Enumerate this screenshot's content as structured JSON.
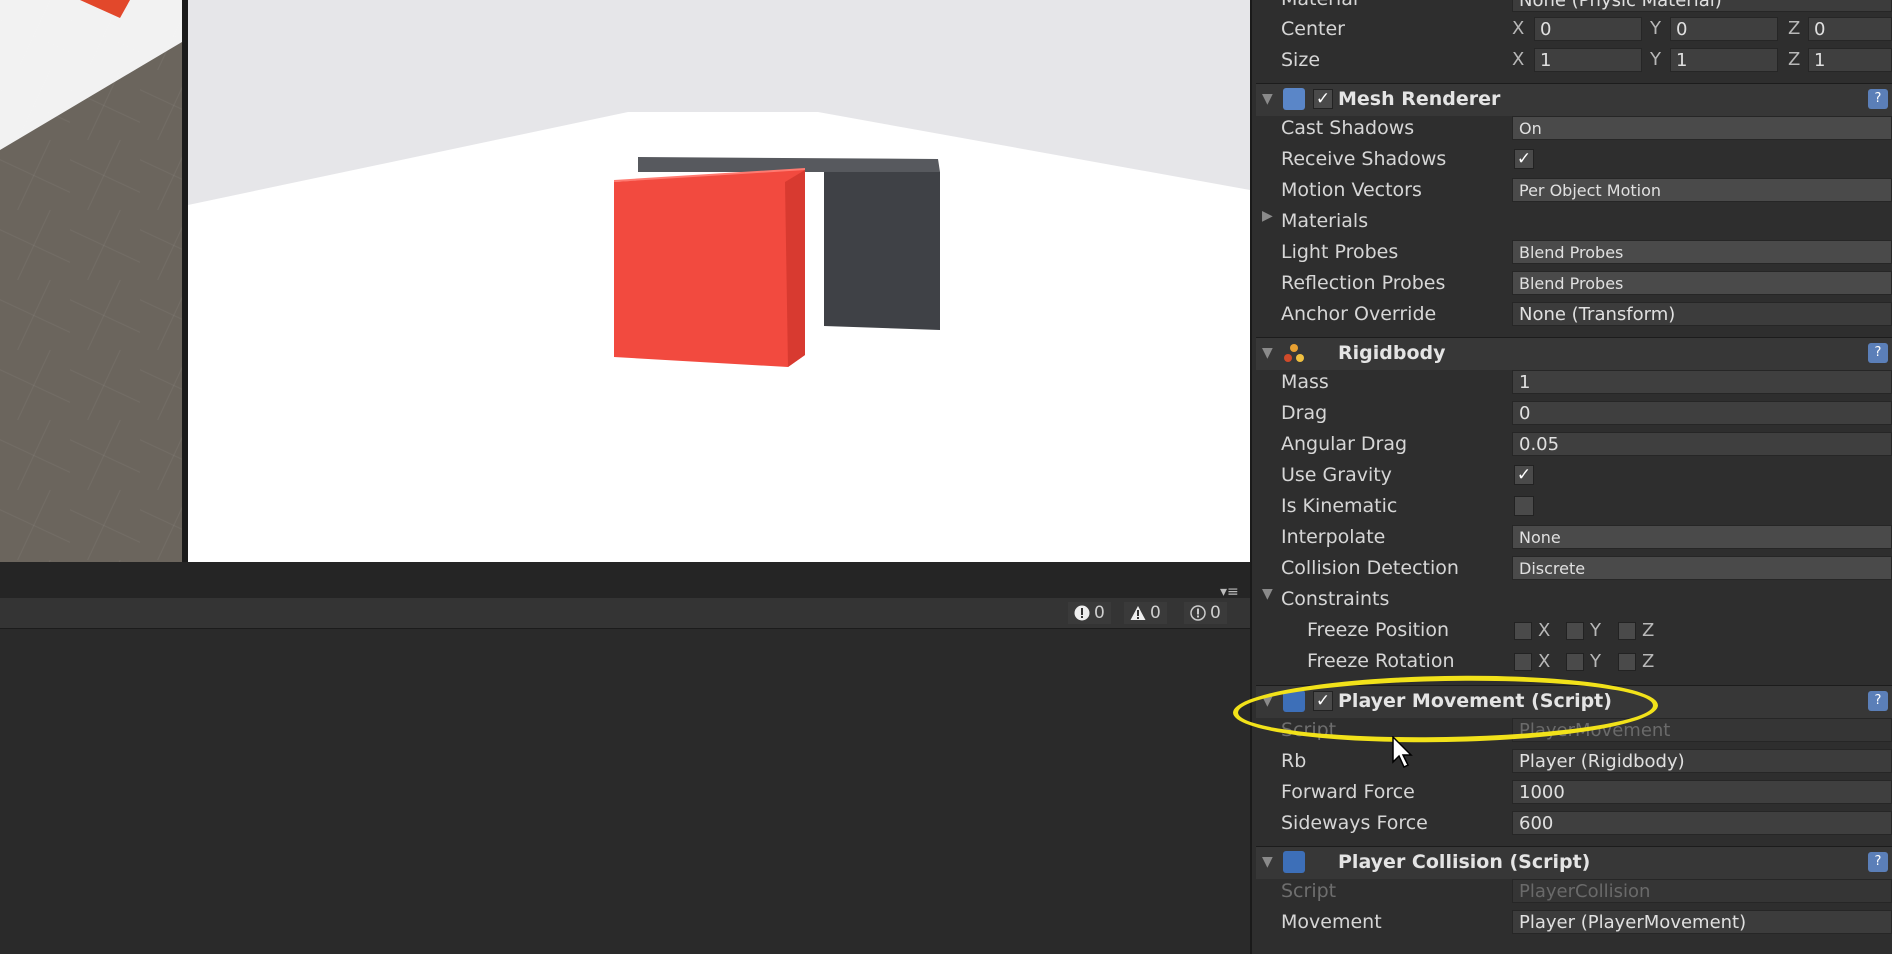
{
  "console": {
    "errors": "0",
    "warnings": "0",
    "messages": "0"
  },
  "inspector": {
    "box_collider": {
      "material_label": "Material",
      "material_value": "None (Physic Material)",
      "center_label": "Center",
      "center": {
        "x": "0",
        "y": "0",
        "z": "0"
      },
      "size_label": "Size",
      "size": {
        "x": "1",
        "y": "1",
        "z": "1"
      }
    },
    "mesh_renderer": {
      "title": "Mesh Renderer",
      "cast_shadows_label": "Cast Shadows",
      "cast_shadows": "On",
      "receive_shadows_label": "Receive Shadows",
      "receive_shadows": "✓",
      "motion_vectors_label": "Motion Vectors",
      "motion_vectors": "Per Object Motion",
      "materials_label": "Materials",
      "light_probes_label": "Light Probes",
      "light_probes": "Blend Probes",
      "reflection_probes_label": "Reflection Probes",
      "reflection_probes": "Blend Probes",
      "anchor_override_label": "Anchor Override",
      "anchor_override": "None (Transform)"
    },
    "rigidbody": {
      "title": "Rigidbody",
      "mass_label": "Mass",
      "mass": "1",
      "drag_label": "Drag",
      "drag": "0",
      "angular_drag_label": "Angular Drag",
      "angular_drag": "0.05",
      "use_gravity_label": "Use Gravity",
      "use_gravity": "✓",
      "is_kinematic_label": "Is Kinematic",
      "interpolate_label": "Interpolate",
      "interpolate": "None",
      "collision_detection_label": "Collision Detection",
      "collision_detection": "Discrete",
      "constraints_label": "Constraints",
      "freeze_position_label": "Freeze Position",
      "freeze_rotation_label": "Freeze Rotation",
      "axis_x": "X",
      "axis_y": "Y",
      "axis_z": "Z"
    },
    "player_movement": {
      "title": "Player Movement (Script)",
      "script_label": "Script",
      "script_value": "PlayerMovement",
      "rb_label": "Rb",
      "rb_value": "Player (Rigidbody)",
      "forward_force_label": "Forward Force",
      "forward_force": "1000",
      "sideways_force_label": "Sideways Force",
      "sideways_force": "600"
    },
    "player_collision": {
      "title": "Player Collision (Script)",
      "script_label": "Script",
      "script_value": "PlayerCollision",
      "movement_label": "Movement",
      "movement_value": "Player (PlayerMovement)"
    },
    "help_glyph": "?"
  },
  "colors": {
    "player_cube": "#f24a3f",
    "obstacle": "#3f4146",
    "highlight": "#f2e21a",
    "help_icon": "#5b7fb8"
  }
}
